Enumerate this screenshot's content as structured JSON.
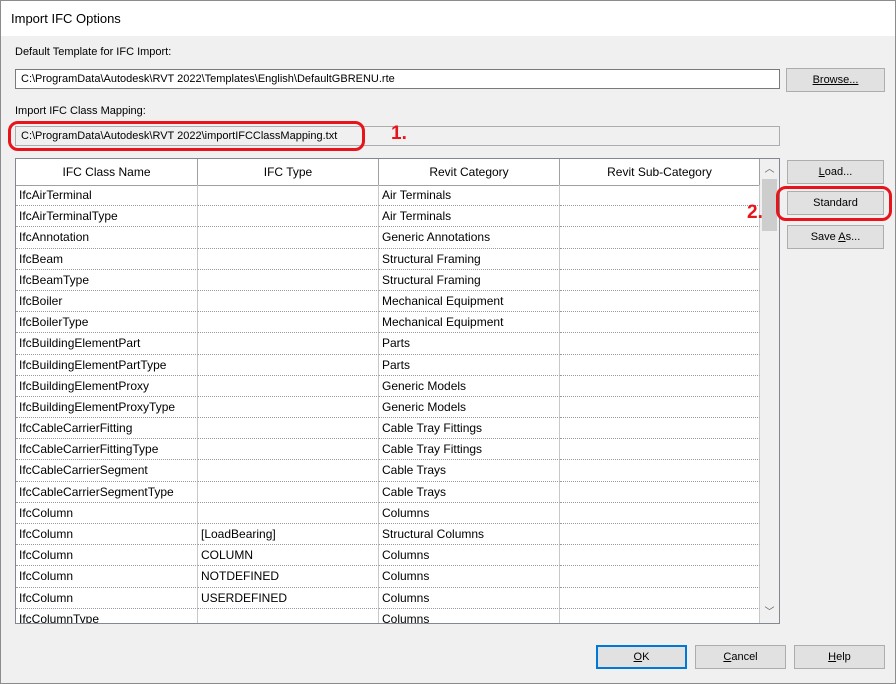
{
  "window": {
    "title": "Import IFC Options"
  },
  "template": {
    "label": "Default Template for IFC Import:",
    "value": "C:\\ProgramData\\Autodesk\\RVT 2022\\Templates\\English\\DefaultGBRENU.rte",
    "browse_label": "Browse..."
  },
  "mapping": {
    "label": "Import IFC Class Mapping:",
    "value": "C:\\ProgramData\\Autodesk\\RVT 2022\\importIFCClassMapping.txt"
  },
  "annotations": {
    "one": "1.",
    "two": "2.",
    "color": "#e8141c"
  },
  "table": {
    "headers": [
      "IFC Class Name",
      "IFC Type",
      "Revit Category",
      "Revit Sub-Category"
    ],
    "rows": [
      [
        "IfcAirTerminal",
        "",
        "Air Terminals",
        ""
      ],
      [
        "IfcAirTerminalType",
        "",
        "Air Terminals",
        ""
      ],
      [
        "IfcAnnotation",
        "",
        "Generic Annotations",
        ""
      ],
      [
        "IfcBeam",
        "",
        "Structural Framing",
        ""
      ],
      [
        "IfcBeamType",
        "",
        "Structural Framing",
        ""
      ],
      [
        "IfcBoiler",
        "",
        "Mechanical Equipment",
        ""
      ],
      [
        "IfcBoilerType",
        "",
        "Mechanical Equipment",
        ""
      ],
      [
        "IfcBuildingElementPart",
        "",
        "Parts",
        ""
      ],
      [
        "IfcBuildingElementPartType",
        "",
        "Parts",
        ""
      ],
      [
        "IfcBuildingElementProxy",
        "",
        "Generic Models",
        ""
      ],
      [
        "IfcBuildingElementProxyType",
        "",
        "Generic Models",
        ""
      ],
      [
        "IfcCableCarrierFitting",
        "",
        "Cable Tray Fittings",
        ""
      ],
      [
        "IfcCableCarrierFittingType",
        "",
        "Cable Tray Fittings",
        ""
      ],
      [
        "IfcCableCarrierSegment",
        "",
        "Cable Trays",
        ""
      ],
      [
        "IfcCableCarrierSegmentType",
        "",
        "Cable Trays",
        ""
      ],
      [
        "IfcColumn",
        "",
        "Columns",
        ""
      ],
      [
        "IfcColumn",
        "[LoadBearing]",
        "Structural Columns",
        ""
      ],
      [
        "IfcColumn",
        "COLUMN",
        "Columns",
        ""
      ],
      [
        "IfcColumn",
        "NOTDEFINED",
        "Columns",
        ""
      ],
      [
        "IfcColumn",
        "USERDEFINED",
        "Columns",
        ""
      ],
      [
        "IfcColumnType",
        "",
        "Columns",
        ""
      ]
    ]
  },
  "side_buttons": {
    "load_pre": "",
    "load_ul": "L",
    "load_post": "oad...",
    "standard": "Standard",
    "saveas_pre": "Save ",
    "saveas_ul": "A",
    "saveas_post": "s..."
  },
  "footer": {
    "ok_ul": "O",
    "ok_post": "K",
    "cancel_ul": "C",
    "cancel_post": "ancel",
    "help_ul": "H",
    "help_post": "elp"
  }
}
